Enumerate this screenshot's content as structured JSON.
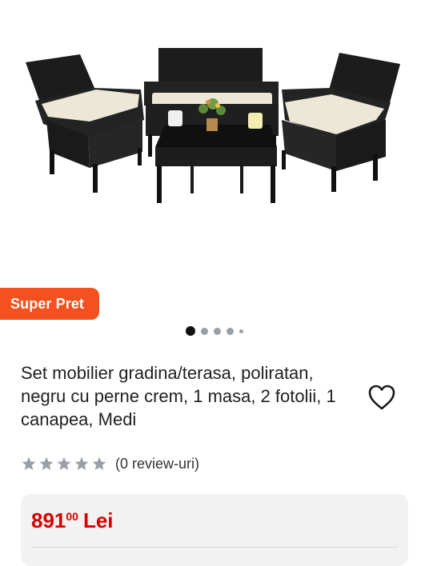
{
  "product": {
    "image_alt": "Set mobilier gradina rattan negru",
    "badge": "Super Pret",
    "carousel": {
      "count": 5,
      "active": 1
    },
    "title": "Set mobilier gradina/terasa, poliratan, negru cu perne crem, 1 masa, 2 fotolii, 1 canapea, Medi",
    "favorite_icon": "heart-outline-icon",
    "rating": {
      "value": 0,
      "max": 5,
      "reviews_label": "(0 review-uri)"
    },
    "price": {
      "integer": "891",
      "decimals": "00",
      "currency": "Lei"
    }
  },
  "colors": {
    "badge": "#f4511e",
    "price": "#d50000",
    "star_empty": "#9aa0a6",
    "card_bg": "#f2f2f2"
  }
}
